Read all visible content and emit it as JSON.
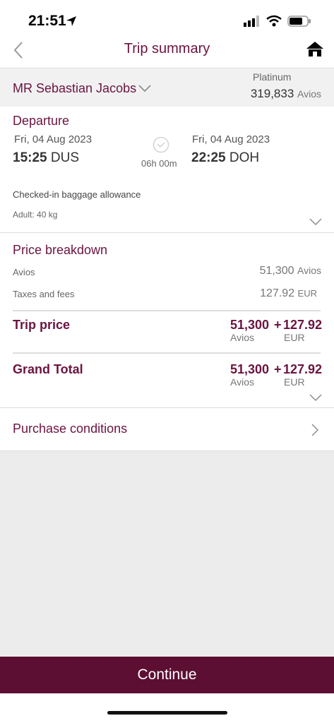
{
  "status_bar": {
    "time": "21:51"
  },
  "header": {
    "title": "Trip summary",
    "back_icon": "chevron-left-icon",
    "home_icon": "home-icon"
  },
  "passenger": {
    "name": "MR Sebastian Jacobs",
    "tier": "Platinum",
    "avios_balance": "319,833",
    "avios_unit": "Avios"
  },
  "departure": {
    "heading": "Departure",
    "origin_date": "Fri, 04 Aug 2023",
    "origin_time": "15:25",
    "origin_code": "DUS",
    "duration": "06h 00m",
    "dest_date": "Fri, 04 Aug 2023",
    "dest_time": "22:25",
    "dest_code": "DOH",
    "baggage_label": "Checked-in baggage allowance",
    "baggage_value": "Adult: 40 kg"
  },
  "price": {
    "heading": "Price breakdown",
    "avios_label": "Avios",
    "avios_value": "51,300",
    "avios_unit": "Avios",
    "taxes_label": "Taxes and fees",
    "taxes_value": "127.92",
    "taxes_unit": "EUR",
    "trip_label": "Trip price",
    "trip_avios": "51,300",
    "plus": "+",
    "trip_eur": "127.92",
    "trip_avios_unit": "Avios",
    "trip_eur_unit": "EUR",
    "grand_label": "Grand Total",
    "grand_avios": "51,300",
    "grand_eur": "127.92",
    "grand_avios_unit": "Avios",
    "grand_eur_unit": "EUR"
  },
  "purchase": {
    "label": "Purchase conditions"
  },
  "cta": {
    "label": "Continue"
  },
  "colors": {
    "brand": "#6b1440",
    "cta": "#5c0f33"
  }
}
